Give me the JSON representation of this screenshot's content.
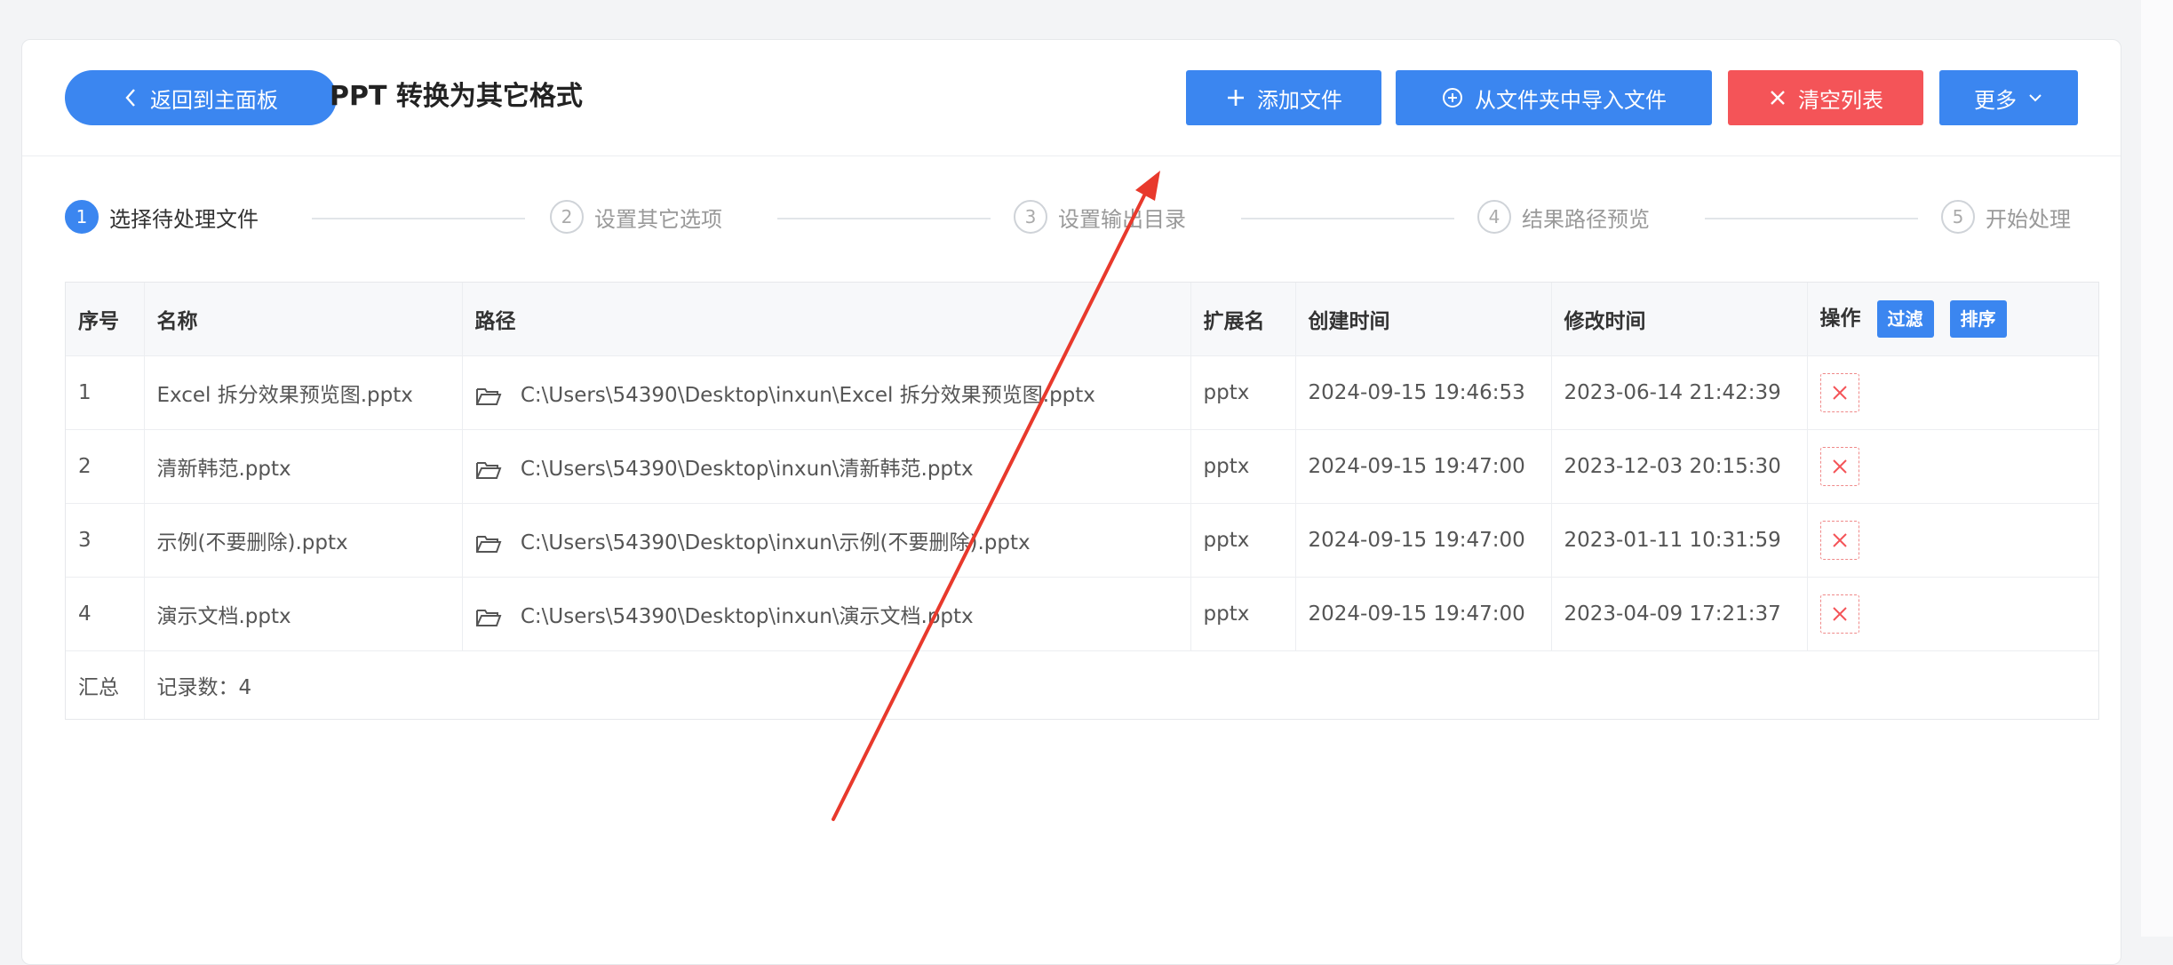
{
  "header": {
    "back_label": "返回到主面板",
    "title": "PPT 转换为其它格式",
    "add_file": "添加文件",
    "import_folder": "从文件夹中导入文件",
    "clear_list": "清空列表",
    "more": "更多"
  },
  "steps": [
    {
      "num": "1",
      "label": "选择待处理文件"
    },
    {
      "num": "2",
      "label": "设置其它选项"
    },
    {
      "num": "3",
      "label": "设置输出目录"
    },
    {
      "num": "4",
      "label": "结果路径预览"
    },
    {
      "num": "5",
      "label": "开始处理"
    }
  ],
  "table": {
    "columns": [
      "序号",
      "名称",
      "路径",
      "扩展名",
      "创建时间",
      "修改时间",
      "操作"
    ],
    "filter_label": "过滤",
    "sort_label": "排序",
    "rows": [
      {
        "idx": "1",
        "name": "Excel 拆分效果预览图.pptx",
        "path": "C:\\Users\\54390\\Desktop\\inxun\\Excel 拆分效果预览图.pptx",
        "ext": "pptx",
        "created": "2024-09-15 19:46:53",
        "modified": "2023-06-14 21:42:39"
      },
      {
        "idx": "2",
        "name": "清新韩范.pptx",
        "path": "C:\\Users\\54390\\Desktop\\inxun\\清新韩范.pptx",
        "ext": "pptx",
        "created": "2024-09-15 19:47:00",
        "modified": "2023-12-03 20:15:30"
      },
      {
        "idx": "3",
        "name": "示例(不要删除).pptx",
        "path": "C:\\Users\\54390\\Desktop\\inxun\\示例(不要删除).pptx",
        "ext": "pptx",
        "created": "2024-09-15 19:47:00",
        "modified": "2023-01-11 10:31:59"
      },
      {
        "idx": "4",
        "name": "演示文档.pptx",
        "path": "C:\\Users\\54390\\Desktop\\inxun\\演示文档.pptx",
        "ext": "pptx",
        "created": "2024-09-15 19:47:00",
        "modified": "2023-04-09 17:21:37"
      }
    ],
    "summary_label": "汇总",
    "record_count": "记录数：4"
  },
  "colors": {
    "primary": "#3b86f0",
    "danger": "#f45458",
    "arrow": "#e8392c"
  }
}
